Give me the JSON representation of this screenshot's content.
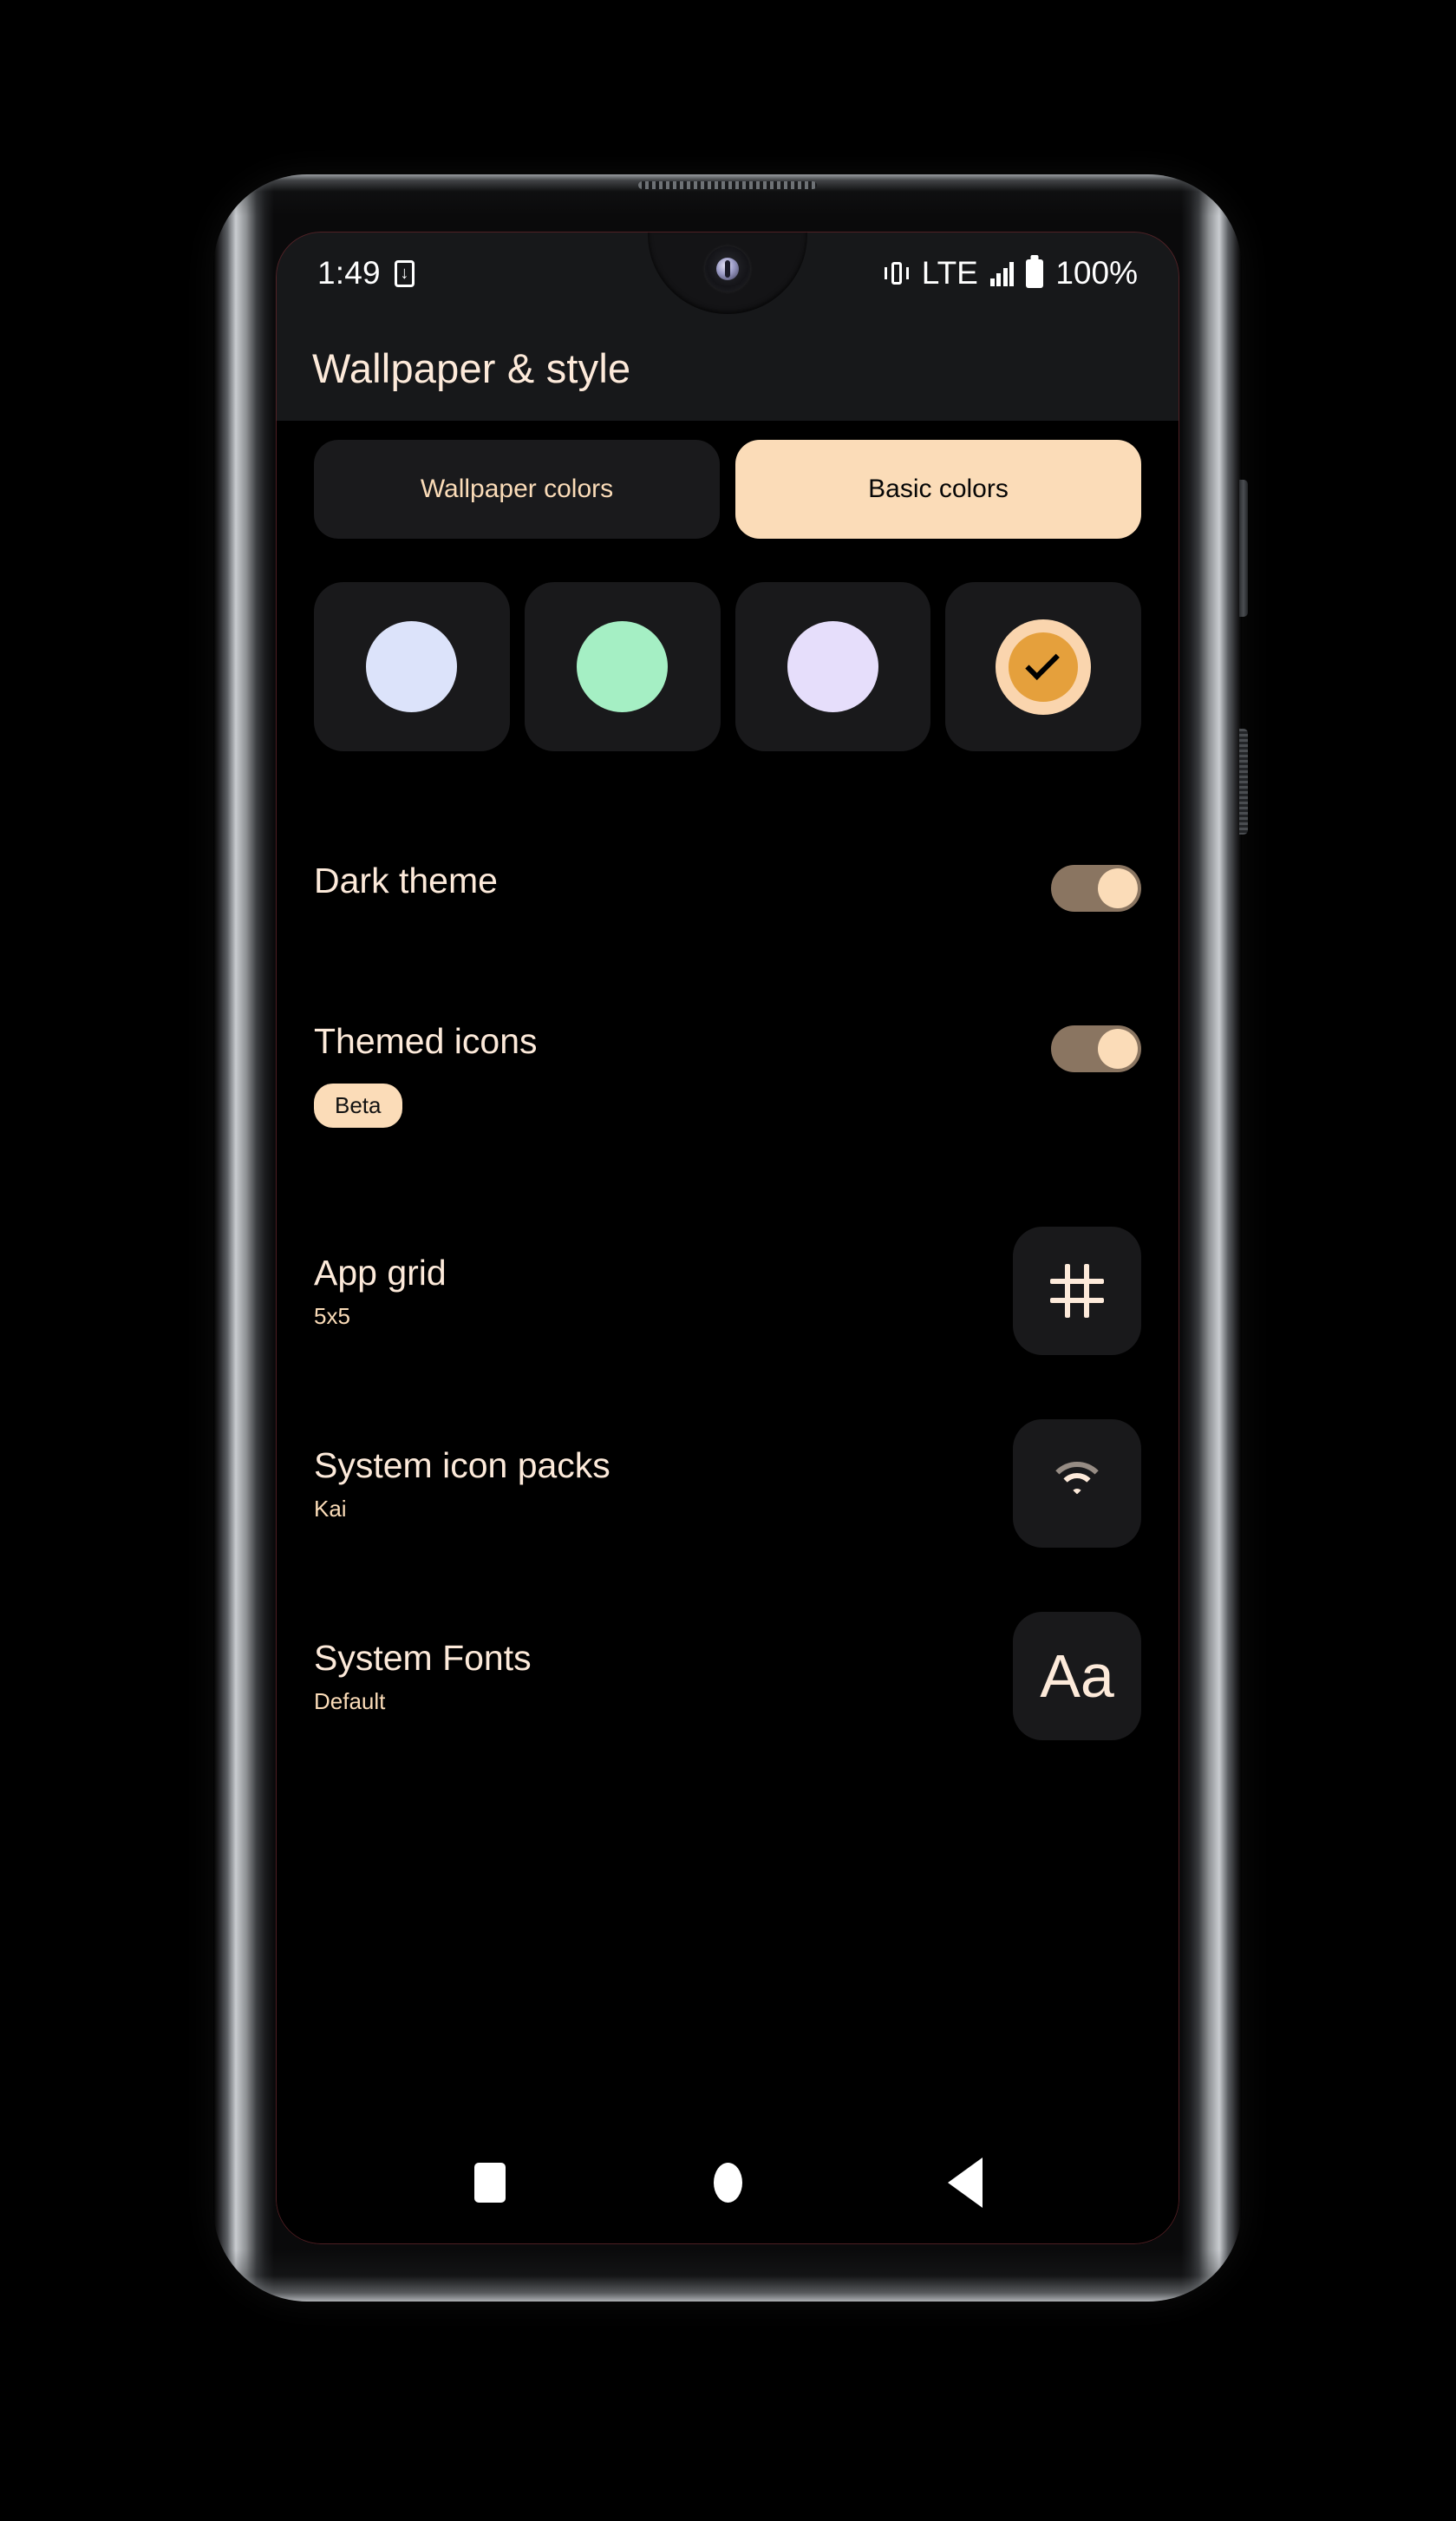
{
  "status_bar": {
    "time": "1:49",
    "download_icon": "download-to-phone-icon",
    "vibrate_icon": "vibrate-icon",
    "network": "LTE",
    "signal_icon": "signal-bars-icon",
    "battery_icon": "battery-full-icon",
    "battery_level": "100%"
  },
  "app_bar": {
    "title": "Wallpaper & style"
  },
  "tabs": [
    {
      "label": "Wallpaper colors",
      "selected": false
    },
    {
      "label": "Basic colors",
      "selected": true
    }
  ],
  "color_swatches": [
    {
      "name": "swatch-blue",
      "color": "#dce3fa",
      "selected": false
    },
    {
      "name": "swatch-green",
      "color": "#a5efc4",
      "selected": false
    },
    {
      "name": "swatch-purple",
      "color": "#e6defb",
      "selected": false
    },
    {
      "name": "swatch-orange",
      "color": "#e5a03c",
      "ring": "#fad5ae",
      "selected": true
    }
  ],
  "settings": {
    "dark_theme": {
      "title": "Dark theme",
      "enabled": true
    },
    "themed_icons": {
      "title": "Themed icons",
      "badge": "Beta",
      "enabled": true
    },
    "app_grid": {
      "title": "App grid",
      "value": "5x5",
      "icon": "grid-icon"
    },
    "icon_packs": {
      "title": "System icon packs",
      "value": "Kai",
      "icon": "wifi-icon"
    },
    "fonts": {
      "title": "System Fonts",
      "value": "Default",
      "icon": "aa-text-icon",
      "glyph": "Aa"
    }
  },
  "nav_bar": {
    "recents": "recents-square",
    "home": "home-circle",
    "back": "back-triangle"
  },
  "theme": {
    "accent": "#fbdcb8",
    "text": "#fdeada",
    "surface": "#1a1a1c",
    "background": "#000000",
    "toggle_track": "#8a7561"
  }
}
